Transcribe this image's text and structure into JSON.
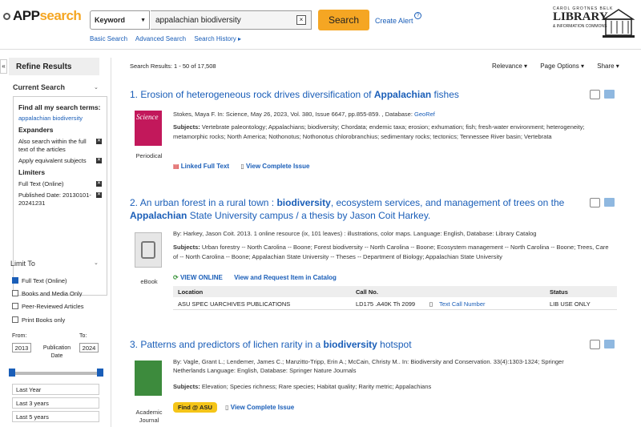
{
  "header": {
    "logo_app": "APP",
    "logo_search": "search",
    "field_select": "Keyword",
    "search_value": "appalachian biodiversity",
    "search_button": "Search",
    "create_alert": "Create Alert",
    "sublinks": [
      "Basic Search",
      "Advanced Search",
      "Search History ▸"
    ],
    "library": {
      "line1": "CAROL GROTNES BELK",
      "line2": "LIBRARY",
      "line3": "& INFORMATION COMMONS"
    }
  },
  "sidebar": {
    "title": "Refine Results",
    "current_search": "Current Search",
    "find_all_label": "Find all my search terms:",
    "find_all_value": "appalachian biodiversity",
    "expanders_label": "Expanders",
    "expanders": [
      "Also search within the full text of the articles",
      "Apply equivalent subjects"
    ],
    "limiters_label": "Limiters",
    "limiters": [
      "Full Text (Online)",
      "Published Date: 20130101-20241231"
    ],
    "limit_to": "Limit To",
    "limit_options": [
      {
        "label": "Full Text (Online)",
        "checked": true
      },
      {
        "label": "Books and Media Only",
        "checked": false
      },
      {
        "label": "Peer-Reviewed Articles",
        "checked": false
      },
      {
        "label": "Print Books only",
        "checked": false
      }
    ],
    "date": {
      "from_label": "From:",
      "to_label": "To:",
      "from": "2013",
      "to": "2024",
      "middle": "Publication Date"
    },
    "presets": [
      "Last Year",
      "Last 3 years",
      "Last 5 years"
    ]
  },
  "results": {
    "count": "Search Results: 1 - 50 of 17,508",
    "toolbar": [
      "Relevance ▾",
      "Page Options ▾",
      "Share ▾"
    ],
    "r1": {
      "num": "1.",
      "t1": "Erosion of heterogeneous rock drives diversification of ",
      "t2": "Appalachian",
      "t3": " fishes",
      "type": "Periodical",
      "meta": "Stokes, Maya F. In: Science, May 26, 2023, Vol. 380, Issue 6647, pp.855-859. , Database: ",
      "db": "GeoRef",
      "subj_label": "Subjects:",
      "subj": " Vertebrate paleontology; Appalachians; biodiversity; Chordata; endemic taxa; erosion; exhumation; fish; fresh-water environment; heterogeneity; metamorphic rocks; North America; Nothonotus; Nothonotus chlorobranchius; sedimentary rocks; tectonics; Tennessee River basin; Vertebrata",
      "a1": "Linked Full Text",
      "a2": "View Complete Issue"
    },
    "r2": {
      "num": "2.",
      "t1": "An urban forest in a rural town : ",
      "t2": "biodiversity",
      "t3": ", ecosystem services, and management of trees on the ",
      "t4": "Appalachian",
      "t5": " State University campus / a thesis by Jason Coit Harkey.",
      "type": "eBook",
      "meta": "By: Harkey, Jason Coit. 2013. 1 online resource (ix, 101 leaves) : illustrations, color maps. Language: English, Database: Library Catalog",
      "subj_label": "Subjects:",
      "subj": " Urban forestry -- North Carolina -- Boone; Forest biodiversity -- North Carolina -- Boone; Ecosystem management -- North Carolina -- Boone; Trees, Care of -- North Carolina -- Boone; Appalachian State University -- Theses -- Department of Biology; Appalachian State University",
      "a1": "VIEW ONLINE",
      "a2": "View and Request Item in Catalog",
      "holdings_headers": [
        "Location",
        "Call No.",
        "Status"
      ],
      "holdings_row": [
        "ASU SPEC UARCHIVES PUBLICATIONS",
        "LD175 .A40K Th 2099",
        "Text Call Number",
        "LIB USE ONLY"
      ]
    },
    "r3": {
      "num": "3.",
      "t1": "Patterns and predictors of lichen rarity in a ",
      "t2": "biodiversity",
      "t3": " hotspot",
      "type": "Academic Journal",
      "meta1": "By: Vagle, Grant L.; Lendemer, James C.; Manzitto-Tripp, Erin A.; McCain, Christy M.. In: Biodiversity and Conservation. 33(4):1303-1324; Springer",
      "meta2": "Netherlands Language: English, Database: Springer Nature Journals",
      "subj_label": "Subjects:",
      "subj": " Elevation; Species richness; Rare species; Habitat quality; Rarity metric; Appalachians",
      "a1": "Find @ ASU",
      "a2": "View Complete Issue"
    }
  }
}
